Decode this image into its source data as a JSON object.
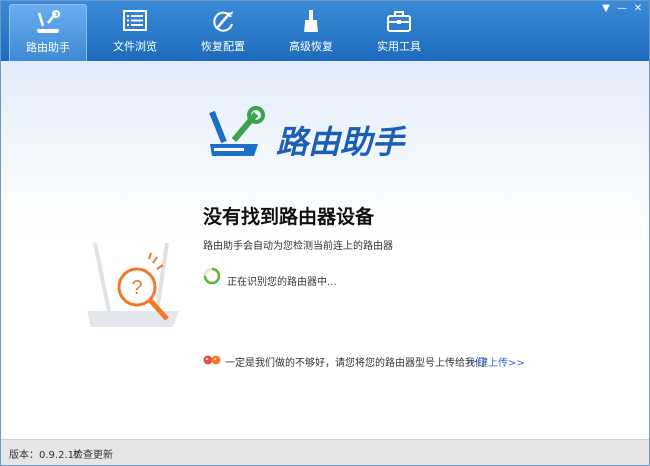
{
  "tabs": [
    {
      "label": "路由助手",
      "icon": "router-tools-icon"
    },
    {
      "label": "文件浏览",
      "icon": "file-list-icon"
    },
    {
      "label": "恢复配置",
      "icon": "restore-icon"
    },
    {
      "label": "高级恢复",
      "icon": "brush-icon"
    },
    {
      "label": "实用工具",
      "icon": "toolbox-icon"
    }
  ],
  "window_controls": {
    "menu": "▼",
    "minimize": "—",
    "close": "✕"
  },
  "logo": {
    "title": "路由助手"
  },
  "main": {
    "heading": "没有找到路由器设备",
    "subtitle": "路由助手会自动为您检测当前连上的路由器",
    "status": "正在识别您的路由器中..."
  },
  "notice": {
    "text": "一定是我们做的不够好，请您将您的路由器型号上传给我们",
    "link": "一键上传>>"
  },
  "footer": {
    "version": "版本：0.9.2.17",
    "check_update": "检查更新"
  },
  "colors": {
    "header": "#2b7cd3",
    "accent": "#f07a2a",
    "link": "#2a6ad0",
    "spinner": "#5fb336"
  }
}
